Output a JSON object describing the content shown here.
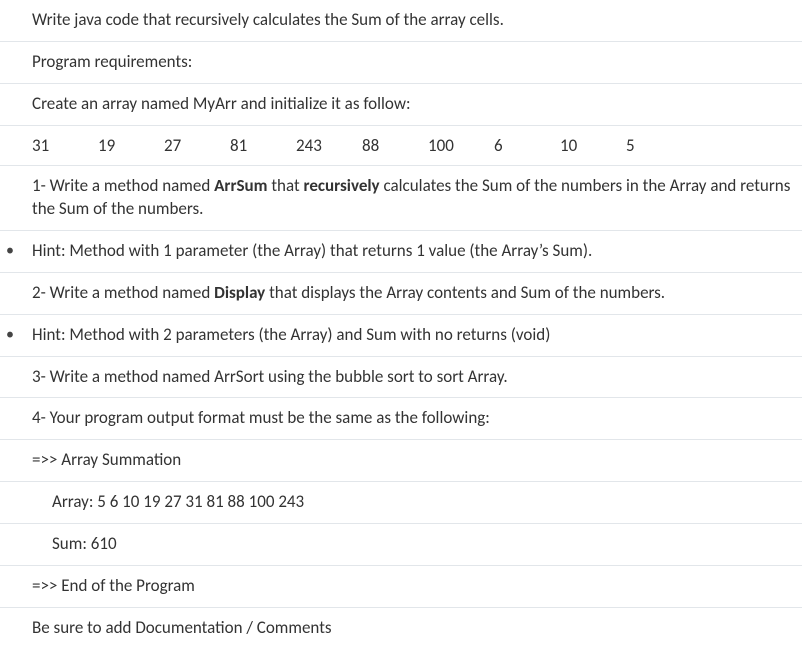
{
  "intro": "Write java code that recursively calculates the Sum of the array cells.",
  "reqHeading": "Program requirements:",
  "createArr": "Create an array named MyArr and initialize it as follow:",
  "arr": [
    "31",
    "19",
    "27",
    "81",
    "243",
    "88",
    "100",
    "6",
    "10",
    "5"
  ],
  "q1_pre": "1-  Write a method named ",
  "q1_b1": "ArrSum",
  "q1_mid": " that ",
  "q1_b2": "recursively",
  "q1_post": " calculates the Sum of the numbers in the Array and returns the Sum of the numbers.",
  "hint1": "Hint: Method with 1 parameter (the Array) that returns 1 value (the Array’s Sum).",
  "q2_pre": "2- Write a method named ",
  "q2_b1": "Display",
  "q2_post": " that displays the Array contents and Sum of the numbers.",
  "hint2": "Hint: Method with 2 parameters (the Array) and Sum with no returns (void)",
  "q3": "3-  Write a method named ArrSort using the bubble sort to sort Array.",
  "q4": "4- Your program output format must be the same as the following:",
  "out1": "=>> Array Summation",
  "out2": "Array: 5 6 10 19 27 31 81 88 100 243",
  "out3": "Sum: 610",
  "out4": "=>> End of the Program",
  "docline": "Be sure to add Documentation / Comments"
}
